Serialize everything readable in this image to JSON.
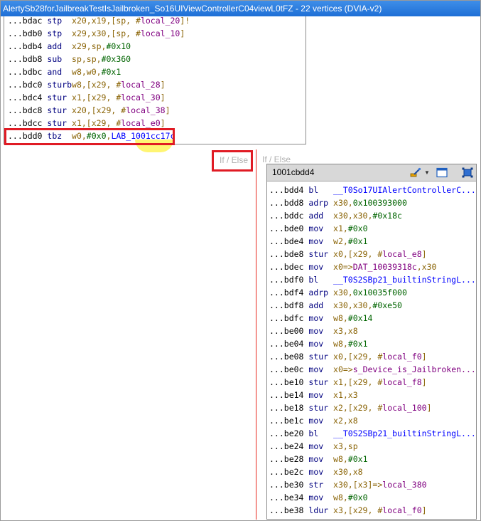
{
  "window": {
    "title": "AlertySb28forJailbreakTestIsJailbroken_So16UIViewControllerC04viewL0tFZ - 22 vertices  (DVIA-v2)"
  },
  "top_block": {
    "lines": [
      {
        "addr": "...bdac",
        "mn": "stp",
        "ops": [
          {
            "t": "x20,x19,[sp, #",
            "c": "reg"
          },
          {
            "t": "local_20",
            "c": "loc"
          },
          {
            "t": "]!",
            "c": "reg"
          }
        ]
      },
      {
        "addr": "...bdb0",
        "mn": "stp",
        "ops": [
          {
            "t": "x29,x30,[sp, #",
            "c": "reg"
          },
          {
            "t": "local_10",
            "c": "loc"
          },
          {
            "t": "]",
            "c": "reg"
          }
        ]
      },
      {
        "addr": "...bdb4",
        "mn": "add",
        "ops": [
          {
            "t": "x29,sp,",
            "c": "reg"
          },
          {
            "t": "#0x10",
            "c": "imm"
          }
        ]
      },
      {
        "addr": "...bdb8",
        "mn": "sub",
        "ops": [
          {
            "t": "sp,sp,",
            "c": "reg"
          },
          {
            "t": "#0x360",
            "c": "imm"
          }
        ]
      },
      {
        "addr": "...bdbc",
        "mn": "and",
        "ops": [
          {
            "t": "w8,w0,",
            "c": "reg"
          },
          {
            "t": "#0x1",
            "c": "imm"
          }
        ]
      },
      {
        "addr": "...bdc0",
        "mn": "sturb",
        "ops": [
          {
            "t": "w8,[x29, #",
            "c": "reg"
          },
          {
            "t": "local_28",
            "c": "loc"
          },
          {
            "t": "]",
            "c": "reg"
          }
        ]
      },
      {
        "addr": "...bdc4",
        "mn": "stur",
        "ops": [
          {
            "t": "x1,[x29, #",
            "c": "reg"
          },
          {
            "t": "local_30",
            "c": "loc"
          },
          {
            "t": "]",
            "c": "reg"
          }
        ]
      },
      {
        "addr": "...bdc8",
        "mn": "stur",
        "ops": [
          {
            "t": "x20,[x29, #",
            "c": "reg"
          },
          {
            "t": "local_38",
            "c": "loc"
          },
          {
            "t": "]",
            "c": "reg"
          }
        ]
      },
      {
        "addr": "...bdcc",
        "mn": "stur",
        "ops": [
          {
            "t": "x1,[x29, #",
            "c": "reg"
          },
          {
            "t": "local_e0",
            "c": "loc"
          },
          {
            "t": "]",
            "c": "reg"
          }
        ]
      },
      {
        "addr": "...bdd0",
        "mn": "tbz",
        "ops": [
          {
            "t": "w0,",
            "c": "reg"
          },
          {
            "t": "#0x0",
            "c": "imm"
          },
          {
            "t": ",",
            "c": "reg"
          },
          {
            "t": "LAB_1001cc17c",
            "c": "lab"
          }
        ]
      }
    ]
  },
  "edges": {
    "label_left": "If / Else",
    "label_right": "If / Else"
  },
  "block_2": {
    "title": "1001cbdd4",
    "lines": [
      {
        "addr": "...bdd4",
        "mn": "bl",
        "ops": [
          {
            "t": "__T0So17UIAlertControllerC...",
            "c": "lab"
          }
        ]
      },
      {
        "addr": "...bdd8",
        "mn": "adrp",
        "ops": [
          {
            "t": "x30,",
            "c": "reg"
          },
          {
            "t": "0x100393000",
            "c": "imm"
          }
        ]
      },
      {
        "addr": "...bddc",
        "mn": "add",
        "ops": [
          {
            "t": "x30,x30,",
            "c": "reg"
          },
          {
            "t": "#0x18c",
            "c": "imm"
          }
        ]
      },
      {
        "addr": "...bde0",
        "mn": "mov",
        "ops": [
          {
            "t": "x1,",
            "c": "reg"
          },
          {
            "t": "#0x0",
            "c": "imm"
          }
        ]
      },
      {
        "addr": "...bde4",
        "mn": "mov",
        "ops": [
          {
            "t": "w2,",
            "c": "reg"
          },
          {
            "t": "#0x1",
            "c": "imm"
          }
        ]
      },
      {
        "addr": "...bde8",
        "mn": "stur",
        "ops": [
          {
            "t": "x0,[x29, #",
            "c": "reg"
          },
          {
            "t": "local_e8",
            "c": "loc"
          },
          {
            "t": "]",
            "c": "reg"
          }
        ]
      },
      {
        "addr": "...bdec",
        "mn": "mov",
        "ops": [
          {
            "t": "x0=>",
            "c": "reg"
          },
          {
            "t": "DAT_10039318c",
            "c": "loc"
          },
          {
            "t": ",x30",
            "c": "reg"
          }
        ]
      },
      {
        "addr": "...bdf0",
        "mn": "bl",
        "ops": [
          {
            "t": "__T0S2SBp21_builtinStringL...",
            "c": "lab"
          }
        ]
      },
      {
        "addr": "...bdf4",
        "mn": "adrp",
        "ops": [
          {
            "t": "x30,",
            "c": "reg"
          },
          {
            "t": "0x10035f000",
            "c": "imm"
          }
        ]
      },
      {
        "addr": "...bdf8",
        "mn": "add",
        "ops": [
          {
            "t": "x30,x30,",
            "c": "reg"
          },
          {
            "t": "#0xe50",
            "c": "imm"
          }
        ]
      },
      {
        "addr": "...bdfc",
        "mn": "mov",
        "ops": [
          {
            "t": "w8,",
            "c": "reg"
          },
          {
            "t": "#0x14",
            "c": "imm"
          }
        ]
      },
      {
        "addr": "...be00",
        "mn": "mov",
        "ops": [
          {
            "t": "x3,x8",
            "c": "reg"
          }
        ]
      },
      {
        "addr": "...be04",
        "mn": "mov",
        "ops": [
          {
            "t": "w8,",
            "c": "reg"
          },
          {
            "t": "#0x1",
            "c": "imm"
          }
        ]
      },
      {
        "addr": "...be08",
        "mn": "stur",
        "ops": [
          {
            "t": "x0,[x29, #",
            "c": "reg"
          },
          {
            "t": "local_f0",
            "c": "loc"
          },
          {
            "t": "]",
            "c": "reg"
          }
        ]
      },
      {
        "addr": "...be0c",
        "mn": "mov",
        "ops": [
          {
            "t": "x0=>",
            "c": "reg"
          },
          {
            "t": "s_Device_is_Jailbroken...",
            "c": "loc"
          }
        ]
      },
      {
        "addr": "...be10",
        "mn": "stur",
        "ops": [
          {
            "t": "x1,[x29, #",
            "c": "reg"
          },
          {
            "t": "local_f8",
            "c": "loc"
          },
          {
            "t": "]",
            "c": "reg"
          }
        ]
      },
      {
        "addr": "...be14",
        "mn": "mov",
        "ops": [
          {
            "t": "x1,x3",
            "c": "reg"
          }
        ]
      },
      {
        "addr": "...be18",
        "mn": "stur",
        "ops": [
          {
            "t": "x2,[x29, #",
            "c": "reg"
          },
          {
            "t": "local_100",
            "c": "loc"
          },
          {
            "t": "]",
            "c": "reg"
          }
        ]
      },
      {
        "addr": "...be1c",
        "mn": "mov",
        "ops": [
          {
            "t": "x2,x8",
            "c": "reg"
          }
        ]
      },
      {
        "addr": "...be20",
        "mn": "bl",
        "ops": [
          {
            "t": "__T0S2SBp21_builtinStringL...",
            "c": "lab"
          }
        ]
      },
      {
        "addr": "...be24",
        "mn": "mov",
        "ops": [
          {
            "t": "x3,sp",
            "c": "reg"
          }
        ]
      },
      {
        "addr": "...be28",
        "mn": "mov",
        "ops": [
          {
            "t": "w8,",
            "c": "reg"
          },
          {
            "t": "#0x1",
            "c": "imm"
          }
        ]
      },
      {
        "addr": "...be2c",
        "mn": "mov",
        "ops": [
          {
            "t": "x30,x8",
            "c": "reg"
          }
        ]
      },
      {
        "addr": "...be30",
        "mn": "str",
        "ops": [
          {
            "t": "x30,[x3]=>",
            "c": "reg"
          },
          {
            "t": "local_380",
            "c": "loc"
          }
        ]
      },
      {
        "addr": "...be34",
        "mn": "mov",
        "ops": [
          {
            "t": "w8,",
            "c": "reg"
          },
          {
            "t": "#0x0",
            "c": "imm"
          }
        ]
      },
      {
        "addr": "...be38",
        "mn": "ldur",
        "ops": [
          {
            "t": "x3,[x29, #",
            "c": "reg"
          },
          {
            "t": "local_f0",
            "c": "loc"
          },
          {
            "t": "]",
            "c": "reg"
          }
        ]
      }
    ]
  },
  "icons": {
    "paint": "paintbrush-icon",
    "dropdown": "chevron-down-icon",
    "window": "window-icon",
    "fullscreen": "fullscreen-icon"
  }
}
